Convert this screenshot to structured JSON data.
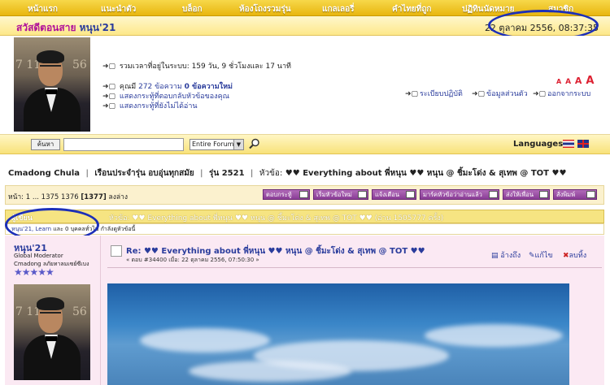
{
  "nav": {
    "items": [
      "หน้าแรก",
      "แนะนำตัว",
      "บล็อก",
      "ห้องโถงรวมรุ่น",
      "แกลเลอรี่",
      "คำไทยที่ถูก",
      "ปฏิทินนัดหมาย",
      "สมาชิก"
    ]
  },
  "greeting": {
    "prefix": "สวัสดีตอนสาย",
    "username": "หนุน'21",
    "datetime": "22 ตุลาคม 2556, 08:37:35"
  },
  "profile": {
    "login_time": "รวมเวลาที่อยู่ในระบบ: 159 วัน, 9 ชั่วโมงและ 17 นาที",
    "msg_prefix": "คุณมี",
    "msg_count": "272 ข้อความ",
    "msg_new": "0 ข้อความใหม่",
    "replies_link": "แสดงกระทู้ที่ตอบกลับหัวข้อของคุณ",
    "unread_link": "แสดงกระทู้ที่ยังไม่ได้อ่าน",
    "font_sizes": [
      "A",
      "A",
      "A",
      "A"
    ],
    "right_links": [
      "ระเบียบปฏิบัติ",
      "ข้อมูลส่วนตัว",
      "ออกจากระบบ"
    ]
  },
  "search": {
    "button": "ค้นหา",
    "scope": "Entire Forum",
    "languages_label": "Languages"
  },
  "breadcrumb": {
    "items": [
      "Cmadong Chula",
      "เรือนประจำรุ่น อบอุ่นทุกสมัย",
      "รุ่น 2521"
    ],
    "topic_prefix": "หัวข้อ:",
    "topic": "♥♥ Everything about พี่หนุน ♥♥ หนุน @ ชิ้มะโด่ง & สุเทพ @ TOT ♥♥"
  },
  "pagination": {
    "label": "หน้า: 1 ... 1375 1376",
    "current": "[1377]",
    "down": "ลงล่าง"
  },
  "actions": [
    "ตอบกระทู้",
    "เริ่มหัวข้อใหม่",
    "แจ้งเตือน",
    "มาร์คหัวข้อว่าอ่านแล้ว",
    "ส่งให้เพื่อน",
    "สั่งพิมพ์"
  ],
  "post_header": {
    "author_label": "ผู้เขียน",
    "title": "หัวข้อ: ♥♥ Everything about พี่หนุน ♥♥ หนุน @ ชิ้มะโด่ง & สุเทพ @ TOT ♥♥  (อ่าน 1505777 ครั้ง)"
  },
  "viewers": {
    "text_a": "หนุน'21, Learn",
    "text_b": "และ 0 บุคคลทั่วไป กำลังดูหัวข้อนี้"
  },
  "post": {
    "username": "หนุน'21",
    "role": "Global Moderator",
    "rank": "Cmadong ลภัยทาลมเซย์ซีเบง",
    "stars": "★★★★★",
    "title": "Re: ♥♥ Everything about พี่หนุน ♥♥ หนุน @ ชิ้มะโด่ง & สุเทพ @ TOT ♥♥",
    "meta": "« ตอบ #34400 เมื่อ: 22 ตุลาคม 2556, 07:50:30 »",
    "actions": [
      "อ้างถึง",
      "แก้ไข",
      "ลบทิ้ง"
    ]
  },
  "colors": {
    "nav_gold": "#e8b60f",
    "greeting_magenta": "#b0119a",
    "link_blue": "#2a3c9c",
    "annotation_circle": "#1c2fb8",
    "button_purple": "#8a3d96",
    "post_bg_pink": "#fbe9f3"
  },
  "icons": [
    "arrow-bullet-icon",
    "magnifier-icon",
    "thai-flag-icon",
    "uk-flag-icon",
    "quote-icon",
    "edit-icon",
    "delete-icon",
    "post-icon"
  ]
}
